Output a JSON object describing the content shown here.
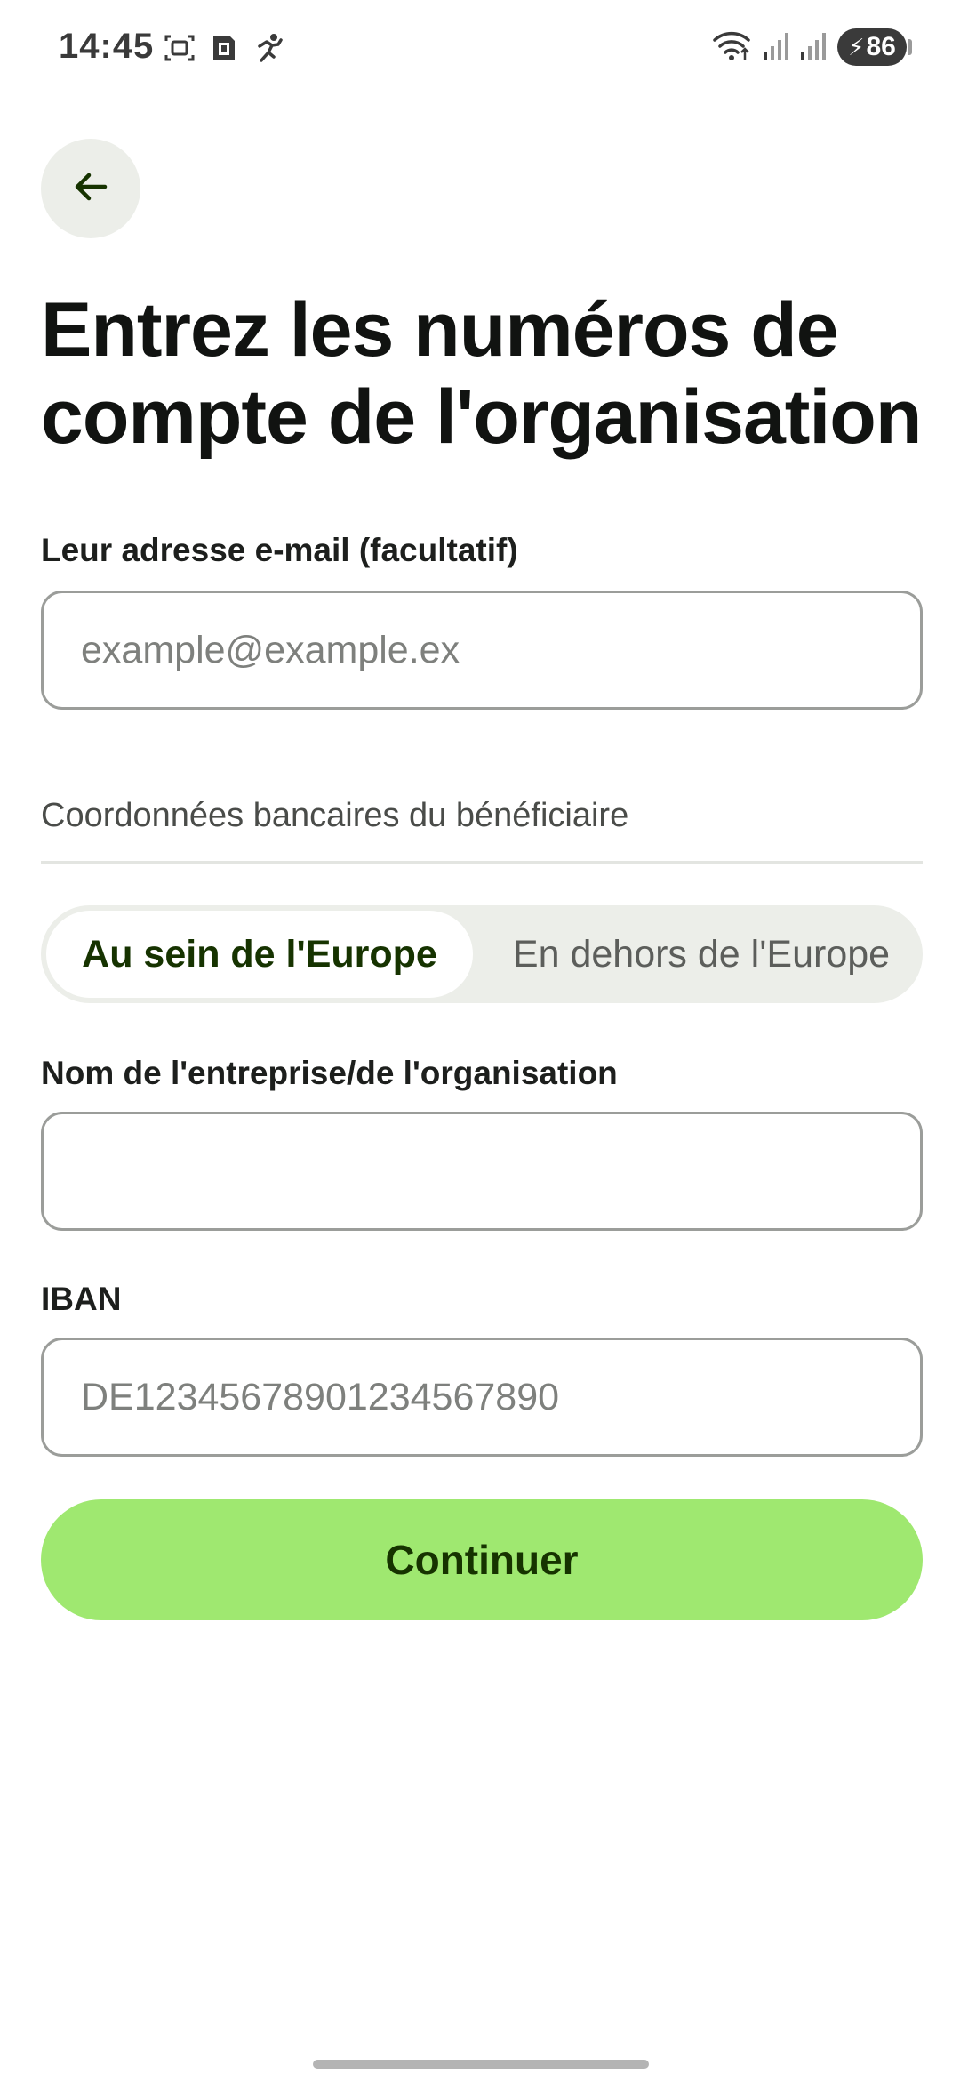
{
  "status_bar": {
    "time": "14:45",
    "battery_level": "86",
    "left_icons": [
      "screenshot-icon",
      "sim-card-icon",
      "activity-icon"
    ],
    "right_icons": [
      "wifi-icon",
      "signal-icon",
      "signal-icon",
      "battery-charging-icon"
    ]
  },
  "header": {
    "back_icon": "arrow-left-icon",
    "title": "Entrez les numéros de compte de l'organisation"
  },
  "form": {
    "email": {
      "label": "Leur adresse e-mail (facultatif)",
      "value": "",
      "placeholder": "example@example.ex"
    },
    "bank_section_heading": "Coordonnées bancaires du bénéficiaire",
    "region_toggle": {
      "options": [
        "Au sein de l'Europe",
        "En dehors de l'Europe"
      ],
      "selected": "Au sein de l'Europe"
    },
    "company_name": {
      "label": "Nom de l'entreprise/de l'organisation",
      "value": "",
      "placeholder": ""
    },
    "iban": {
      "label": "IBAN",
      "value": "",
      "placeholder": "DE12345678901234567890"
    },
    "continue_label": "Continuer"
  },
  "colors": {
    "accent_green": "#9fe870",
    "dark_green": "#163300",
    "chip_background": "#eceee9"
  }
}
